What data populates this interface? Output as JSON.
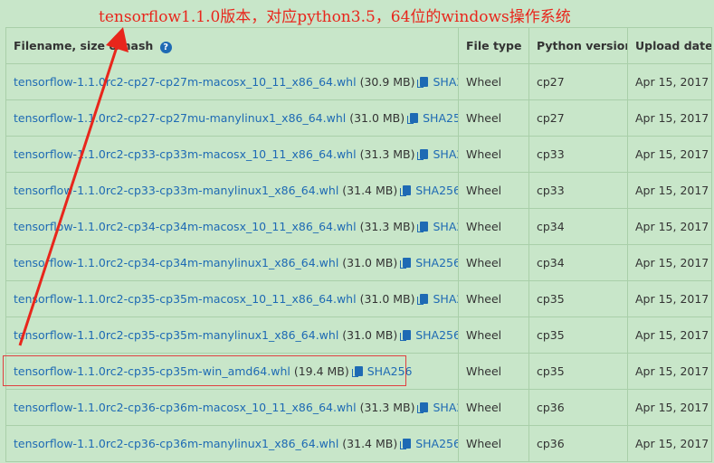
{
  "annotation": {
    "title": "tensorflow1.1.0版本，对应python3.5，64位的windows操作系统",
    "color": "#e8261c"
  },
  "table": {
    "headers": {
      "filename": "Filename, size & hash",
      "help_icon": "?",
      "file_type": "File type",
      "python_version": "Python version",
      "upload_date": "Upload date"
    },
    "hash_label": "SHA256",
    "rows": [
      {
        "name": "tensorflow-1.1.0rc2-cp27-cp27m-macosx_10_11_x86_64.whl",
        "size": "(30.9 MB)",
        "type": "Wheel",
        "pyver": "cp27",
        "date": "Apr 15, 2017"
      },
      {
        "name": "tensorflow-1.1.0rc2-cp27-cp27mu-manylinux1_x86_64.whl",
        "size": "(31.0 MB)",
        "type": "Wheel",
        "pyver": "cp27",
        "date": "Apr 15, 2017"
      },
      {
        "name": "tensorflow-1.1.0rc2-cp33-cp33m-macosx_10_11_x86_64.whl",
        "size": "(31.3 MB)",
        "type": "Wheel",
        "pyver": "cp33",
        "date": "Apr 15, 2017"
      },
      {
        "name": "tensorflow-1.1.0rc2-cp33-cp33m-manylinux1_x86_64.whl",
        "size": "(31.4 MB)",
        "type": "Wheel",
        "pyver": "cp33",
        "date": "Apr 15, 2017"
      },
      {
        "name": "tensorflow-1.1.0rc2-cp34-cp34m-macosx_10_11_x86_64.whl",
        "size": "(31.3 MB)",
        "type": "Wheel",
        "pyver": "cp34",
        "date": "Apr 15, 2017"
      },
      {
        "name": "tensorflow-1.1.0rc2-cp34-cp34m-manylinux1_x86_64.whl",
        "size": "(31.0 MB)",
        "type": "Wheel",
        "pyver": "cp34",
        "date": "Apr 15, 2017"
      },
      {
        "name": "tensorflow-1.1.0rc2-cp35-cp35m-macosx_10_11_x86_64.whl",
        "size": "(31.0 MB)",
        "type": "Wheel",
        "pyver": "cp35",
        "date": "Apr 15, 2017"
      },
      {
        "name": "tensorflow-1.1.0rc2-cp35-cp35m-manylinux1_x86_64.whl",
        "size": "(31.0 MB)",
        "type": "Wheel",
        "pyver": "cp35",
        "date": "Apr 15, 2017"
      },
      {
        "name": "tensorflow-1.1.0rc2-cp35-cp35m-win_amd64.whl",
        "size": "(19.4 MB)",
        "type": "Wheel",
        "pyver": "cp35",
        "date": "Apr 15, 2017"
      },
      {
        "name": "tensorflow-1.1.0rc2-cp36-cp36m-macosx_10_11_x86_64.whl",
        "size": "(31.3 MB)",
        "type": "Wheel",
        "pyver": "cp36",
        "date": "Apr 15, 2017"
      },
      {
        "name": "tensorflow-1.1.0rc2-cp36-cp36m-manylinux1_x86_64.whl",
        "size": "(31.4 MB)",
        "type": "Wheel",
        "pyver": "cp36",
        "date": "Apr 15, 2017"
      }
    ]
  },
  "colors": {
    "background": "#c8e6c9",
    "link": "#1e6ab4",
    "highlight": "#e04040"
  }
}
